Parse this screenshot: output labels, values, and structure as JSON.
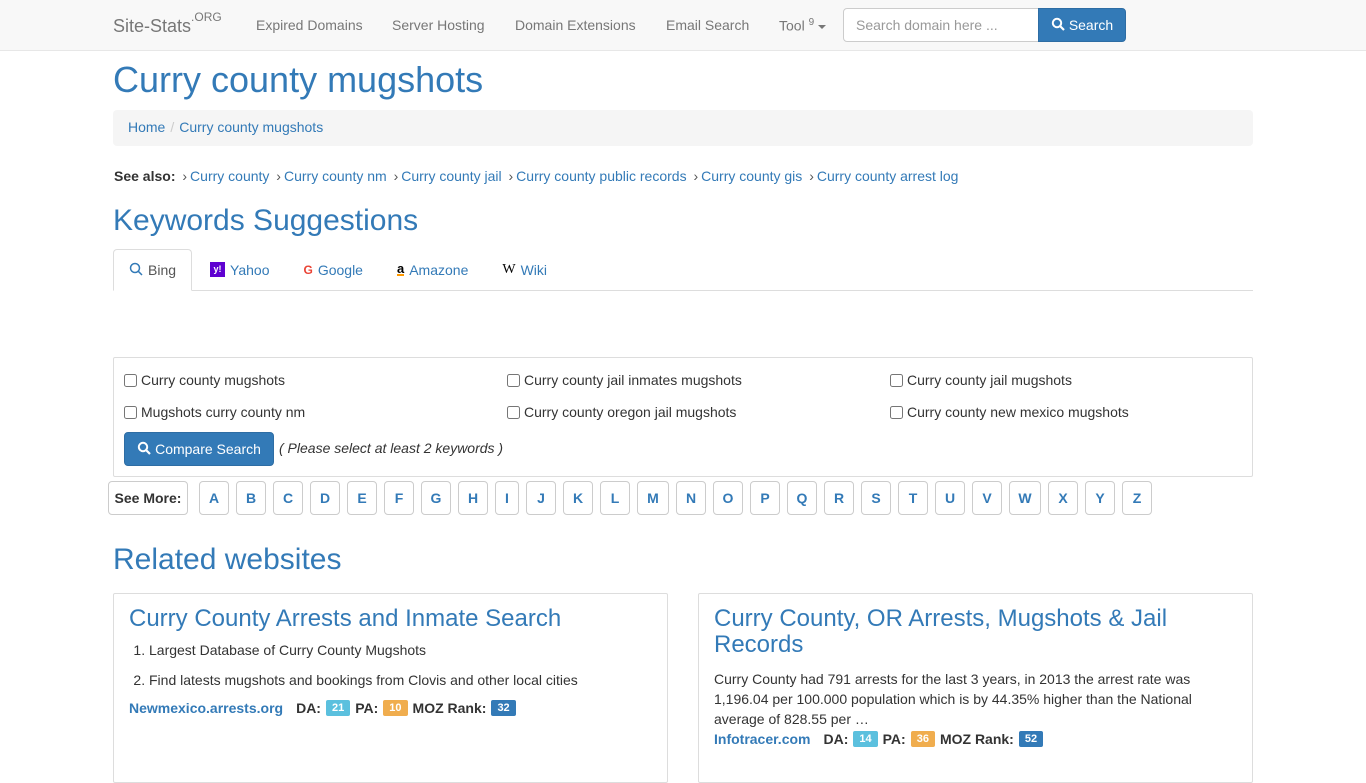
{
  "navbar": {
    "brand": "Site-Stats",
    "brand_sup": ".ORG",
    "items": [
      "Expired Domains",
      "Server Hosting",
      "Domain Extensions",
      "Email Search"
    ],
    "tool": "Tool",
    "tool_badge": "9",
    "search_placeholder": "Search domain here ...",
    "search_label": "Search"
  },
  "page_title": "Curry county mugshots",
  "breadcrumb": [
    "Home",
    "Curry county mugshots"
  ],
  "see_also": {
    "label": "See also:",
    "links": [
      "Curry county",
      "Curry county nm",
      "Curry county jail",
      "Curry county public records",
      "Curry county gis",
      "Curry county arrest log"
    ]
  },
  "keywords": {
    "heading": "Keywords Suggestions",
    "tabs": [
      "Bing",
      "Yahoo",
      "Google",
      "Amazone",
      "Wiki"
    ],
    "items": [
      "Curry county mugshots",
      "Curry county jail inmates mugshots",
      "Curry county jail mugshots",
      "Mugshots curry county nm",
      "Curry county oregon jail mugshots",
      "Curry county new mexico mugshots"
    ],
    "compare_label": "Compare Search",
    "hint": "( Please select at least 2 keywords )"
  },
  "see_more": {
    "label": "See More:",
    "letters": [
      "A",
      "B",
      "C",
      "D",
      "E",
      "F",
      "G",
      "H",
      "I",
      "J",
      "K",
      "L",
      "M",
      "N",
      "O",
      "P",
      "Q",
      "R",
      "S",
      "T",
      "U",
      "V",
      "W",
      "X",
      "Y",
      "Z"
    ]
  },
  "related": {
    "heading": "Related websites",
    "cards": [
      {
        "title": "Curry County Arrests and Inmate Search",
        "list": [
          "Largest Database of Curry County Mugshots",
          "Find latests mugshots and bookings from Clovis and other local cities"
        ],
        "domain": "Newmexico.arrests.org",
        "da": "21",
        "pa": "10",
        "moz": "32"
      },
      {
        "title": "Curry County, OR Arrests, Mugshots & Jail Records",
        "desc": "Curry County had 791 arrests for the last 3 years, in 2013 the arrest rate was 1,196.04 per 100.000 population which is by 44.35% higher than the National average of 828.55 per …",
        "domain": "Infotracer.com",
        "da": "14",
        "pa": "36",
        "moz": "52"
      }
    ],
    "labels": {
      "da": "DA:",
      "pa": "PA:",
      "moz": "MOZ Rank:"
    }
  }
}
